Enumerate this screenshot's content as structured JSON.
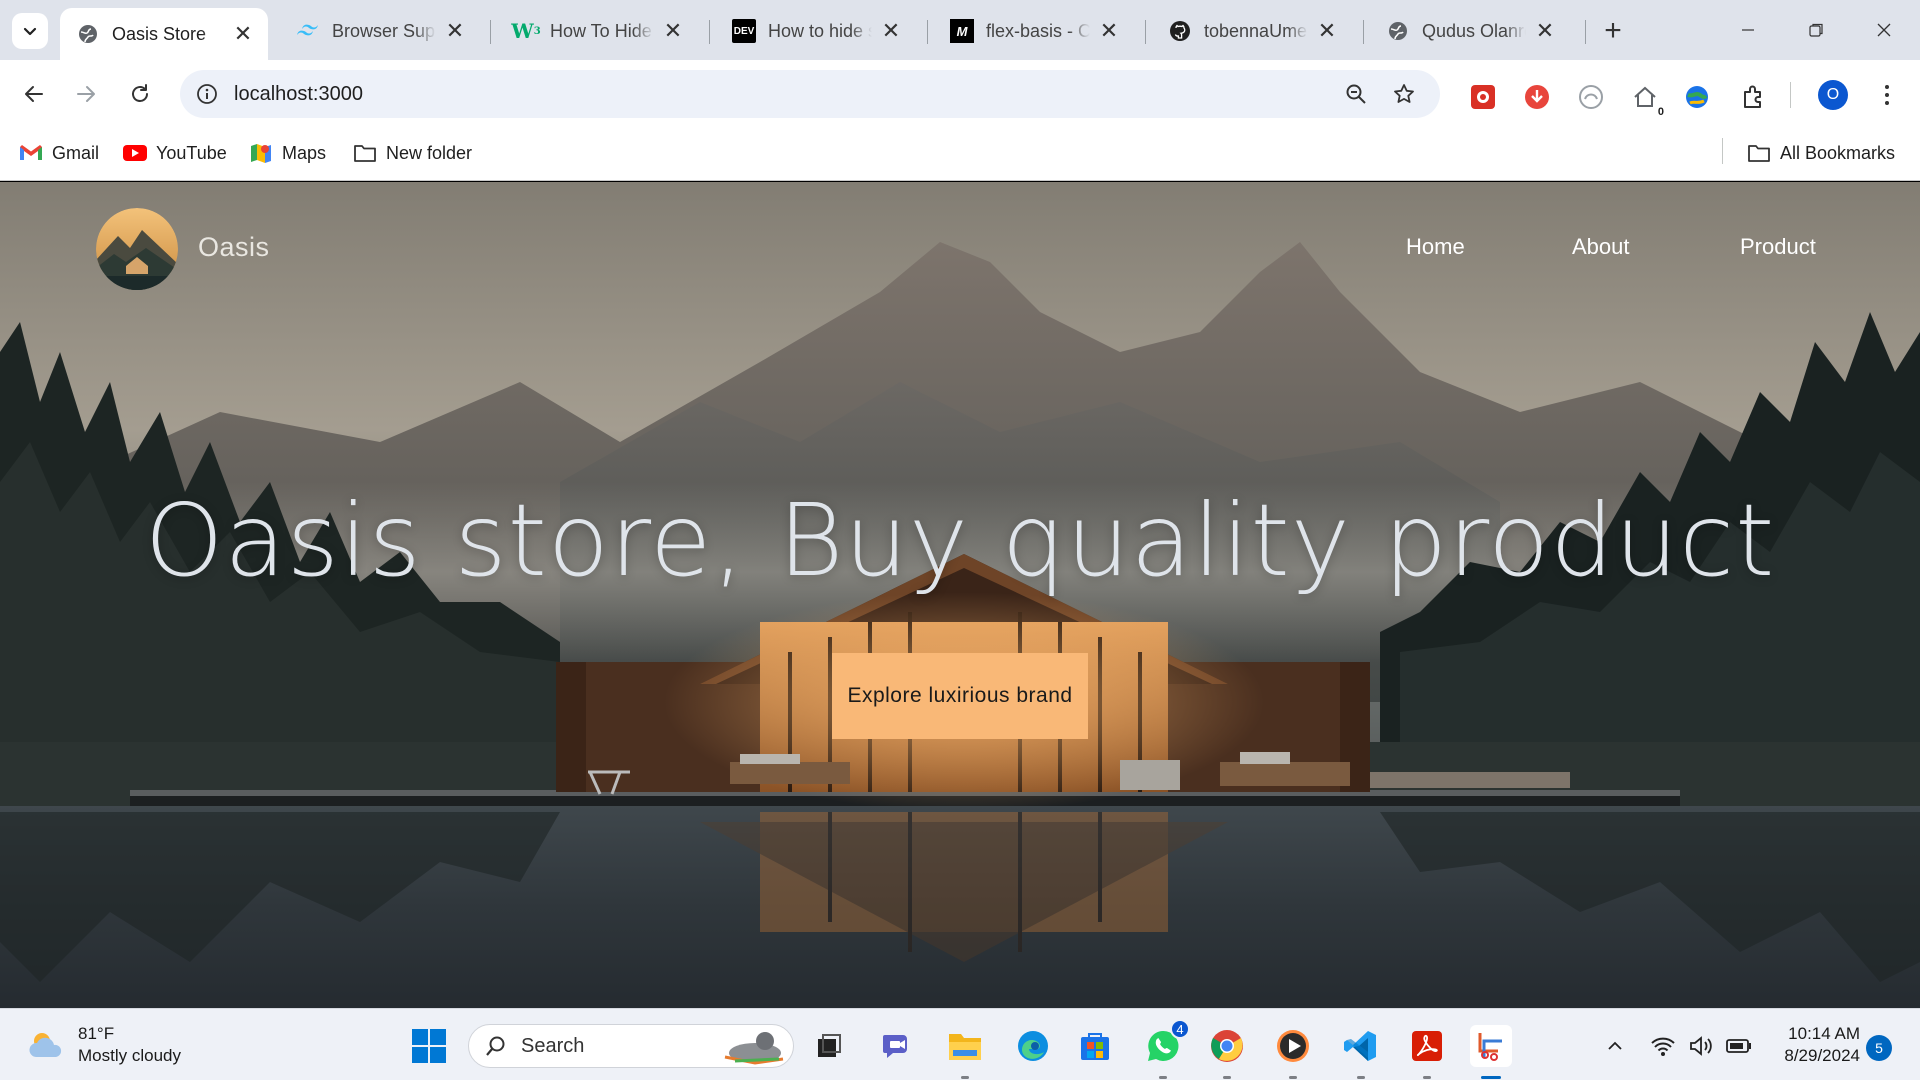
{
  "browser": {
    "tabs": [
      {
        "title": "Oasis Store",
        "icon": "globe-icon",
        "active": true
      },
      {
        "title": "Browser Support",
        "icon": "tailwind-icon"
      },
      {
        "title": "How To Hide Scrollbar",
        "icon": "w3schools-icon"
      },
      {
        "title": "How to hide scrollbar",
        "icon": "dev-icon"
      },
      {
        "title": "flex-basis - CSS",
        "icon": "mdn-icon"
      },
      {
        "title": "tobennaUmeh",
        "icon": "github-icon"
      },
      {
        "title": "Qudus Olanrewaju",
        "icon": "globe-icon"
      }
    ],
    "address": "localhost:3000",
    "profile_initial": "O",
    "extension_badge": "0",
    "bookmarks": [
      {
        "label": "Gmail",
        "icon": "gmail-icon"
      },
      {
        "label": "YouTube",
        "icon": "youtube-icon"
      },
      {
        "label": "Maps",
        "icon": "maps-icon"
      },
      {
        "label": "New folder",
        "icon": "folder-icon"
      }
    ],
    "all_bookmarks": "All Bookmarks"
  },
  "site": {
    "brand": "Oasis",
    "nav": [
      "Home",
      "About",
      "Product"
    ],
    "hero_title": "Oasis store, Buy quality product",
    "cta": "Explore luxirious brand",
    "accent_color": "#f9b877"
  },
  "taskbar": {
    "weather_temp": "81°F",
    "weather_desc": "Mostly cloudy",
    "search_placeholder": "Search",
    "whatsapp_badge": "4",
    "time": "10:14 AM",
    "date": "8/29/2024",
    "notifications": "5"
  }
}
